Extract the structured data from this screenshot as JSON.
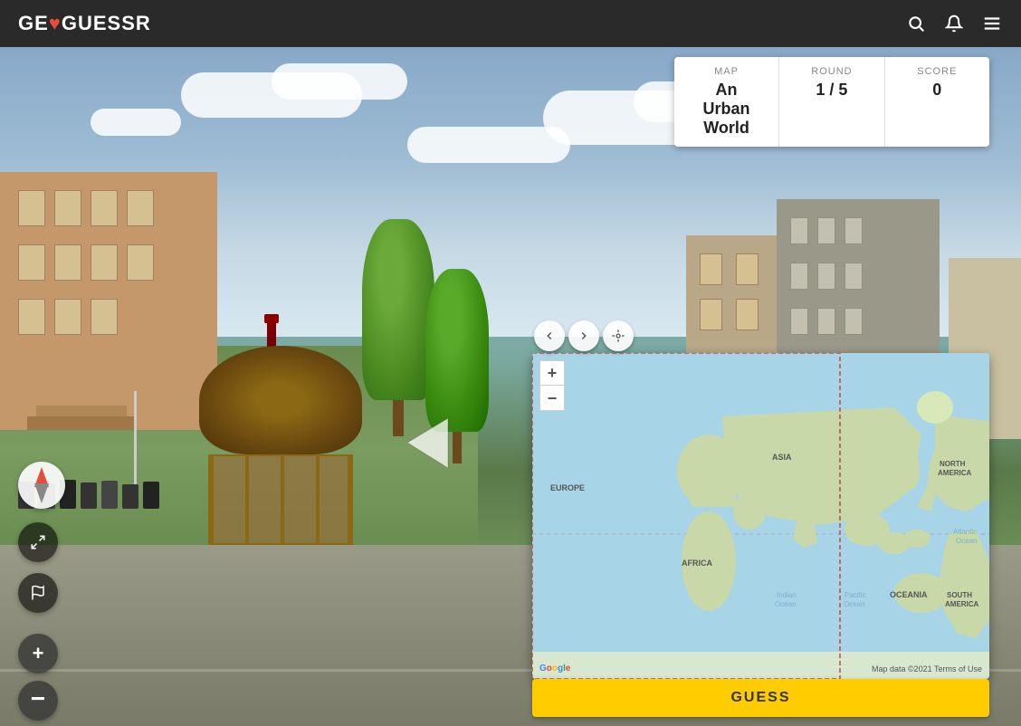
{
  "header": {
    "logo": "GeoGuessr",
    "logo_geo": "GE",
    "logo_heart": "♥",
    "logo_guessr": "GUESSR"
  },
  "score_panel": {
    "map_label": "MAP",
    "map_value": "An Urban World",
    "round_label": "ROUND",
    "round_value": "1 / 5",
    "score_label": "SCORE",
    "score_value": "0"
  },
  "map": {
    "zoom_in": "+",
    "zoom_out": "−",
    "labels": [
      {
        "text": "EUROPE",
        "left": "4",
        "top": "40"
      },
      {
        "text": "ASIA",
        "left": "30",
        "top": "28"
      },
      {
        "text": "AFRICA",
        "left": "18",
        "top": "52"
      },
      {
        "text": "NORTH AMERICA",
        "left": "55",
        "top": "37"
      },
      {
        "text": "SOUTH AMERICA",
        "left": "60",
        "top": "65"
      },
      {
        "text": "OCEANIA",
        "left": "45",
        "top": "68"
      },
      {
        "text": "Atlantic\nOcean",
        "left": "69",
        "top": "46"
      },
      {
        "text": "Pacific\nOcean",
        "left": "52",
        "top": "68"
      },
      {
        "text": "Indian\nOcean",
        "left": "37",
        "top": "68"
      }
    ],
    "footer_text": "Map data ©2021  Terms of Use",
    "google_letters": [
      "G",
      "o",
      "o",
      "g",
      "l",
      "e"
    ]
  },
  "controls": {
    "guess_button": "GUESS"
  },
  "map_controls": {
    "btn1_icon": "◀",
    "btn2_icon": "▶",
    "btn3_icon": "⊙"
  }
}
